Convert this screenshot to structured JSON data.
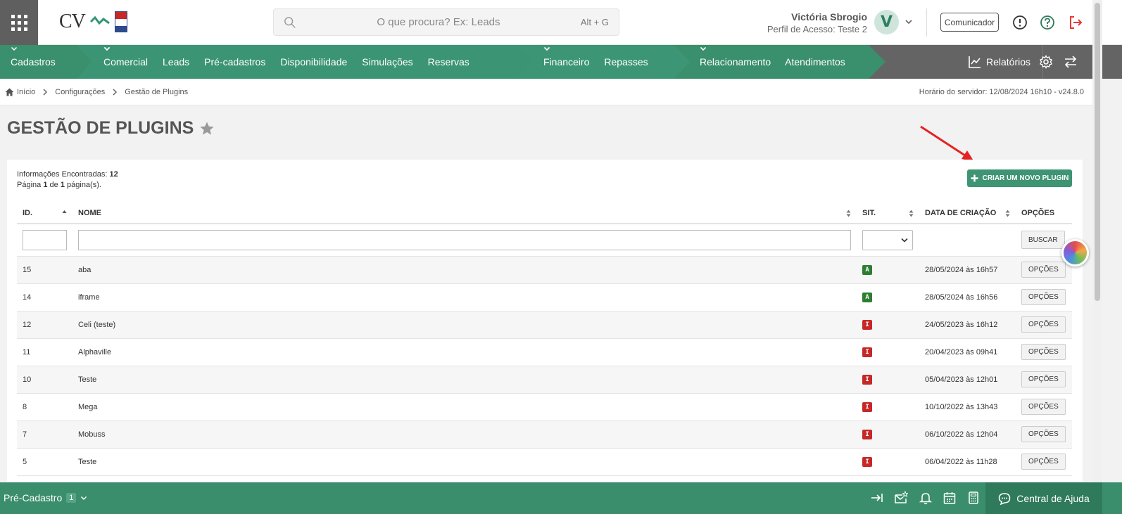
{
  "header": {
    "logo_text": "CV",
    "search_placeholder": "O que procura? Ex: Leads",
    "search_shortcut": "Alt + G",
    "user_name": "Victória Sbrogio",
    "user_profile": "Perfil de Acesso: Teste 2",
    "avatar_letter": "V",
    "comunicador_label": "Comunicador"
  },
  "menu": {
    "group1": [
      "Cadastros"
    ],
    "group2": [
      "Comercial",
      "Leads",
      "Pré-cadastros",
      "Disponibilidade",
      "Simulações",
      "Reservas"
    ],
    "group3": [
      "Financeiro",
      "Repasses"
    ],
    "group4": [
      "Relacionamento",
      "Atendimentos"
    ],
    "relatorios": "Relatórios",
    "colors": {
      "group1": "#3a8f6d",
      "group2": "#3b9473",
      "group3": "#3c9676",
      "group4": "#3a8f6d"
    }
  },
  "breadcrumb": {
    "items": [
      "Início",
      "Configurações",
      "Gestão de Plugins"
    ],
    "server_time": "Horário do servidor: 12/08/2024 16h10 - v24.8.0"
  },
  "page": {
    "title": "GESTÃO DE PLUGINS",
    "info_label": "Informações Encontradas:",
    "info_count": "12",
    "page_prefix": "Página",
    "page_current": "1",
    "page_of": "de",
    "page_total": "1",
    "page_suffix": "página(s).",
    "new_button": "CRIAR UM NOVO PLUGIN"
  },
  "table": {
    "headers": {
      "id": "ID.",
      "nome": "NOME",
      "sit": "SIT.",
      "data": "DATA DE CRIAÇÃO",
      "opcoes": "OPÇÕES"
    },
    "search_button": "BUSCAR",
    "options_button": "OPÇÕES",
    "rows": [
      {
        "id": "15",
        "nome": "aba",
        "sit": "A",
        "data": "28/05/2024 às 16h57"
      },
      {
        "id": "14",
        "nome": "iframe",
        "sit": "A",
        "data": "28/05/2024 às 16h56"
      },
      {
        "id": "12",
        "nome": "Celi (teste)",
        "sit": "I",
        "data": "24/05/2023 às 16h12"
      },
      {
        "id": "11",
        "nome": "Alphaville",
        "sit": "I",
        "data": "20/04/2023 às 09h41"
      },
      {
        "id": "10",
        "nome": "Teste",
        "sit": "I",
        "data": "05/04/2023 às 12h01"
      },
      {
        "id": "8",
        "nome": "Mega",
        "sit": "I",
        "data": "10/10/2022 às 13h43"
      },
      {
        "id": "7",
        "nome": "Mobuss",
        "sit": "I",
        "data": "06/10/2022 às 12h04"
      },
      {
        "id": "5",
        "nome": "Teste",
        "sit": "I",
        "data": "06/04/2022 às 11h28"
      }
    ]
  },
  "footer": {
    "precadastro_label": "Pré-Cadastro",
    "precadastro_count": "1",
    "ajuda_label": "Central de Ajuda"
  }
}
